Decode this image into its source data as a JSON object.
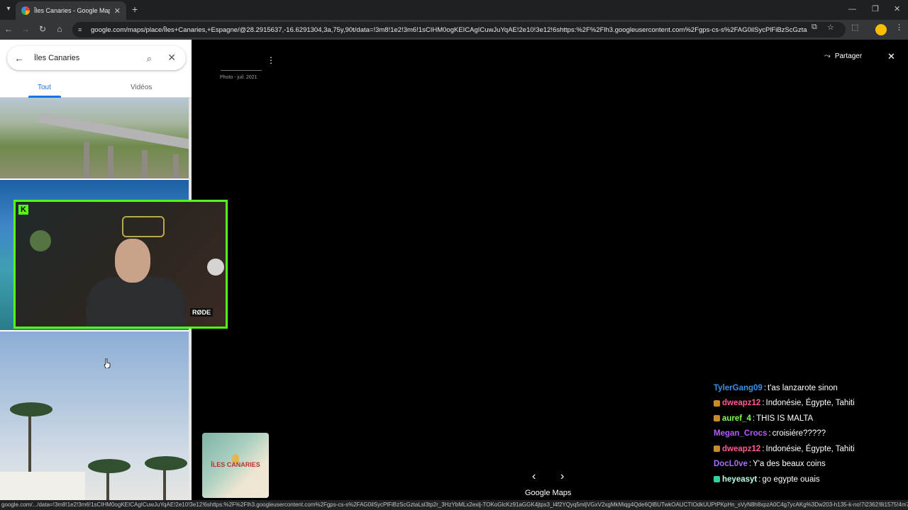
{
  "browser": {
    "tab_title": "Îles Canaries - Google Maps",
    "url": "google.com/maps/place/Îles+Canaries,+Espagne/@28.2915637,-16.6291304,3a,75y,90t/data=!3m8!1e2!3m6!1sCIHM0ogKEICAgICuwJuYqAE!2e10!3e12!6shttps:%2F%2Flh3.googleusercontent.com%2Fgps-cs-s%2FAG0ilSycPlFiBzScGztaLsl3tp2r_3...",
    "status_url": "google.com/.../data=!3m8!1e2!3m6!1sCIHM0ogKEICAgICuwJuYqAE!2e10!3e12!6shttps:%2F%2Flh3.googleusercontent.com%2Fgps-cs-s%2FAG0ilSycPlFiBzScGztaLsl3tp2r_3HzYbMLx2exlj-TOKoGlcKz91aGGK4jtps3_l4f2YQyq5mljVGxV2xgMkMiqg4Qde6QlBUTwkOAUCTIOdkUUPtPKpHn_sVyN8h8xpzA0C4g7ycAKg%3Dw203-h135-k-no!7i2362!8i1575!4m7!3..."
  },
  "search": {
    "query": "Îles Canaries"
  },
  "panel_tabs": {
    "all": "Tout",
    "videos": "Vidéos"
  },
  "viewer": {
    "meta": "Photo - juil. 2021",
    "share": "Partager",
    "thumbnail_label": "ÎLES CANARIES",
    "brand": "Google Maps"
  },
  "webcam": {
    "mic_label": "RØDE"
  },
  "chat": [
    {
      "user": "TylerGang09",
      "color": "#3b8fe8",
      "badge": "",
      "text": "t'as lanzarote sinon"
    },
    {
      "user": "dweapz12",
      "color": "#ff5d8f",
      "badge": "#c98a2b",
      "text": "Indonésie, Égypte, Tahiti"
    },
    {
      "user": "auref_4",
      "color": "#7cff4a",
      "badge": "#c98a2b",
      "text": "THIS IS MALTA"
    },
    {
      "user": "Megan_Crocs",
      "color": "#b05cff",
      "badge": "",
      "text": "croisiére?????"
    },
    {
      "user": "dweapz12",
      "color": "#ff5d8f",
      "badge": "#c98a2b",
      "text": "Indonésie, Égypte, Tahiti"
    },
    {
      "user": "DocL0ve",
      "color": "#a66bff",
      "badge": "",
      "text": "Y'a des beaux coins"
    },
    {
      "user": "heyeasyt",
      "color": "#b8ffe0",
      "badge": "#2fd4a0",
      "text": "go egypte ouais"
    }
  ]
}
